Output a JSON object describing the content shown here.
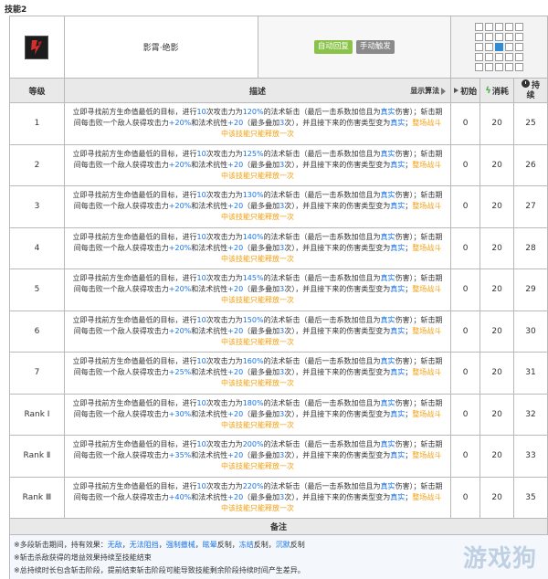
{
  "section_title": "技能2",
  "skill": {
    "name": "影霄·绝影",
    "tags": [
      "自动回复",
      "手动触发"
    ],
    "colors": {
      "auto_tag": "#8bc34a",
      "manual_tag": "#8a8a8a",
      "range_self": "#2f8cd4",
      "highlight_blue": "#1a73e8",
      "highlight_orange": "#f59e0b"
    }
  },
  "columns": {
    "level": "等级",
    "desc": "描述",
    "show_alg": "显示算法",
    "init": "初始",
    "cost": "消耗",
    "dur": "持续"
  },
  "rows": [
    {
      "level": "1",
      "s1": "立即寻找前方生命值最低的目标，进行",
      "hits": "10",
      "s2": "次攻击力为",
      "pct": "120%",
      "s3": "的法术斩击（最后一击系数加倍且为",
      "true1": "真实",
      "s4": "伤害）；斩击期间每击败一个敌人获得攻击力",
      "atk": "+20%",
      "s5": "和法术抗性",
      "res": "+20",
      "s6": "（最多叠加",
      "stack": "3",
      "s7": "次），并且接下来的伤害类型变为",
      "true2": "真实",
      "s8": "；",
      "note": "整场战斗中该技能只能释放一次",
      "init": "0",
      "cost": "20",
      "dur": "25"
    },
    {
      "level": "2",
      "s1": "立即寻找前方生命值最低的目标，进行",
      "hits": "10",
      "s2": "次攻击力为",
      "pct": "125%",
      "s3": "的法术斩击（最后一击系数加倍且为",
      "true1": "真实",
      "s4": "伤害）；斩击期间每击败一个敌人获得攻击力",
      "atk": "+20%",
      "s5": "和法术抗性",
      "res": "+20",
      "s6": "（最多叠加",
      "stack": "3",
      "s7": "次），并且接下来的伤害类型变为",
      "true2": "真实",
      "s8": "；",
      "note": "整场战斗中该技能只能释放一次",
      "init": "0",
      "cost": "20",
      "dur": "26"
    },
    {
      "level": "3",
      "s1": "立即寻找前方生命值最低的目标，进行",
      "hits": "10",
      "s2": "次攻击力为",
      "pct": "130%",
      "s3": "的法术斩击（最后一击系数加倍且为",
      "true1": "真实",
      "s4": "伤害）；斩击期间每击败一个敌人获得攻击力",
      "atk": "+20%",
      "s5": "和法术抗性",
      "res": "+20",
      "s6": "（最多叠加",
      "stack": "3",
      "s7": "次），并且接下来的伤害类型变为",
      "true2": "真实",
      "s8": "；",
      "note": "整场战斗中该技能只能释放一次",
      "init": "0",
      "cost": "20",
      "dur": "27"
    },
    {
      "level": "4",
      "s1": "立即寻找前方生命值最低的目标，进行",
      "hits": "10",
      "s2": "次攻击力为",
      "pct": "140%",
      "s3": "的法术斩击（最后一击系数加倍且为",
      "true1": "真实",
      "s4": "伤害）；斩击期间每击败一个敌人获得攻击力",
      "atk": "+20%",
      "s5": "和法术抗性",
      "res": "+20",
      "s6": "（最多叠加",
      "stack": "3",
      "s7": "次），并且接下来的伤害类型变为",
      "true2": "真实",
      "s8": "；",
      "note": "整场战斗中该技能只能释放一次",
      "init": "0",
      "cost": "20",
      "dur": "28"
    },
    {
      "level": "5",
      "s1": "立即寻找前方生命值最低的目标，进行",
      "hits": "10",
      "s2": "次攻击力为",
      "pct": "145%",
      "s3": "的法术斩击（最后一击系数加倍且为",
      "true1": "真实",
      "s4": "伤害）；斩击期间每击败一个敌人获得攻击力",
      "atk": "+20%",
      "s5": "和法术抗性",
      "res": "+20",
      "s6": "（最多叠加",
      "stack": "3",
      "s7": "次），并且接下来的伤害类型变为",
      "true2": "真实",
      "s8": "；",
      "note": "整场战斗中该技能只能释放一次",
      "init": "0",
      "cost": "20",
      "dur": "29"
    },
    {
      "level": "6",
      "s1": "立即寻找前方生命值最低的目标，进行",
      "hits": "10",
      "s2": "次攻击力为",
      "pct": "150%",
      "s3": "的法术斩击（最后一击系数加倍且为",
      "true1": "真实",
      "s4": "伤害）；斩击期间每击败一个敌人获得攻击力",
      "atk": "+20%",
      "s5": "和法术抗性",
      "res": "+20",
      "s6": "（最多叠加",
      "stack": "3",
      "s7": "次），并且接下来的伤害类型变为",
      "true2": "真实",
      "s8": "；",
      "note": "整场战斗中该技能只能释放一次",
      "init": "0",
      "cost": "20",
      "dur": "30"
    },
    {
      "level": "7",
      "s1": "立即寻找前方生命值最低的目标，进行",
      "hits": "10",
      "s2": "次攻击力为",
      "pct": "160%",
      "s3": "的法术斩击（最后一击系数加倍且为",
      "true1": "真实",
      "s4": "伤害）；斩击期间每击败一个敌人获得攻击力",
      "atk": "+25%",
      "s5": "和法术抗性",
      "res": "+20",
      "s6": "（最多叠加",
      "stack": "3",
      "s7": "次），并且接下来的伤害类型变为",
      "true2": "真实",
      "s8": "；",
      "note": "整场战斗中该技能只能释放一次",
      "init": "0",
      "cost": "20",
      "dur": "31"
    },
    {
      "level": "Rank Ⅰ",
      "s1": "立即寻找前方生命值最低的目标，进行",
      "hits": "10",
      "s2": "次攻击力为",
      "pct": "180%",
      "s3": "的法术斩击（最后一击系数加倍且为",
      "true1": "真实",
      "s4": "伤害）；斩击期间每击败一个敌人获得攻击力",
      "atk": "+30%",
      "s5": "和法术抗性",
      "res": "+20",
      "s6": "（最多叠加",
      "stack": "3",
      "s7": "次），并且接下来的伤害类型变为",
      "true2": "真实",
      "s8": "；",
      "note": "整场战斗中该技能只能释放一次",
      "init": "0",
      "cost": "20",
      "dur": "32"
    },
    {
      "level": "Rank Ⅱ",
      "s1": "立即寻找前方生命值最低的目标，进行",
      "hits": "10",
      "s2": "次攻击力为",
      "pct": "200%",
      "s3": "的法术斩击（最后一击系数加倍且为",
      "true1": "真实",
      "s4": "伤害）；斩击期间每击败一个敌人获得攻击力",
      "atk": "+35%",
      "s5": "和法术抗性",
      "res": "+20",
      "s6": "（最多叠加",
      "stack": "3",
      "s7": "次），并且接下来的伤害类型变为",
      "true2": "真实",
      "s8": "；",
      "note": "整场战斗中该技能只能释放一次",
      "init": "0",
      "cost": "20",
      "dur": "33"
    },
    {
      "level": "Rank Ⅲ",
      "s1": "立即寻找前方生命值最低的目标，进行",
      "hits": "10",
      "s2": "次攻击力为",
      "pct": "220%",
      "s3": "的法术斩击（最后一击系数加倍且为",
      "true1": "真实",
      "s4": "伤害）；斩击期间每击败一个敌人获得攻击力",
      "atk": "+40%",
      "s5": "和法术抗性",
      "res": "+20",
      "s6": "（最多叠加",
      "stack": "3",
      "s7": "次），并且接下来的伤害类型变为",
      "true2": "真实",
      "s8": "；",
      "note": "整场战斗中该技能只能释放一次",
      "init": "0",
      "cost": "20",
      "dur": "35"
    }
  ],
  "notes": {
    "title": "备注",
    "line1": {
      "prefix": "※多段斩击期间，持有效果：",
      "items": [
        "无敌",
        "无法阻挡",
        "强制撤械",
        "眩晕",
        "冻结",
        "沉默"
      ],
      "suffixes": [
        "，",
        "，",
        "，",
        "反制，",
        "反制，",
        "反制"
      ]
    },
    "line2": "※斩击杀敌获得的增益效果持续至技能结束",
    "line3": "※总持续时长包含斩击阶段，提前结束斩击阶段可能导致技能剩余阶段持续时间产生差异。"
  },
  "watermark": "游戏狗"
}
